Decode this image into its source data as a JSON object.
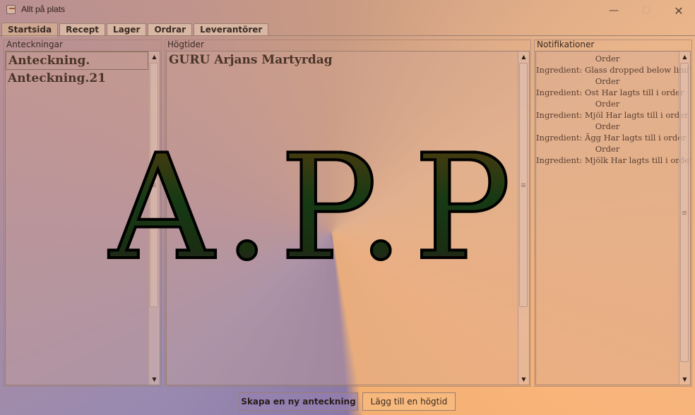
{
  "window": {
    "title": "Allt på plats",
    "minimize": "—",
    "maximize": "☐",
    "close": "✕"
  },
  "tabs": [
    {
      "label": "Startsida",
      "active": true
    },
    {
      "label": "Recept"
    },
    {
      "label": "Lager"
    },
    {
      "label": "Ordrar"
    },
    {
      "label": "Leverantörer"
    }
  ],
  "notes_panel": {
    "title": "Anteckningar",
    "items": [
      "Anteckning.",
      "Anteckning.21"
    ],
    "selected_index": 0
  },
  "holidays_panel": {
    "title": "Högtider",
    "items": [
      "GURU Arjans Martyrdag"
    ]
  },
  "notifications_panel": {
    "title": "Notifikationer",
    "items": [
      "Order",
      "Ingredient: Glass dropped below limit!",
      "Order",
      "Ingredient: Ost Har lagts till i order",
      "Order",
      "Ingredient: Mjöl Har lagts till i order",
      "Order",
      "Ingredient: Ägg Har lagts till i order",
      "Order",
      "Ingredient: Mjölk Har lagts till i order"
    ]
  },
  "watermark": {
    "text": "A.P.P"
  },
  "buttons": {
    "new_note": "Skapa en ny anteckning",
    "add_holiday": "Lägg till en högtid"
  },
  "scroll_arrows": {
    "up": "▲",
    "down": "▼"
  }
}
